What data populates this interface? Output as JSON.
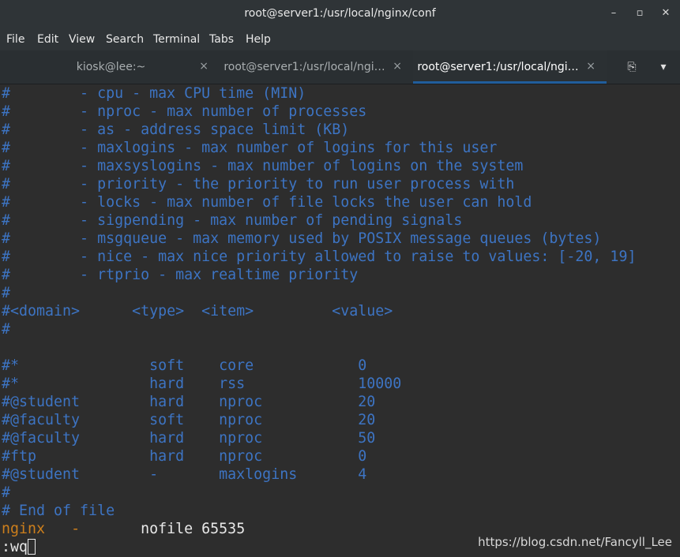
{
  "window": {
    "title": "root@server1:/usr/local/nginx/conf",
    "minimize": "–",
    "maximize": "▫",
    "close": "✕"
  },
  "menu": [
    "File",
    "Edit",
    "View",
    "Search",
    "Terminal",
    "Tabs",
    "Help"
  ],
  "tabs": [
    {
      "label": "kiosk@lee:~",
      "close": "×"
    },
    {
      "label": "root@server1:/usr/local/ngi…",
      "close": "×"
    },
    {
      "label": "root@server1:/usr/local/ngi…",
      "close": "×"
    }
  ],
  "tab_actions": {
    "new_tab_icon": "⎘",
    "menu_icon": "▾"
  },
  "terminal": {
    "lines": [
      "#        - cpu - max CPU time (MIN)",
      "#        - nproc - max number of processes",
      "#        - as - address space limit (KB)",
      "#        - maxlogins - max number of logins for this user",
      "#        - maxsyslogins - max number of logins on the system",
      "#        - priority - the priority to run user process with",
      "#        - locks - max number of file locks the user can hold",
      "#        - sigpending - max number of pending signals",
      "#        - msgqueue - max memory used by POSIX message queues (bytes)",
      "#        - nice - max nice priority allowed to raise to values: [-20, 19]",
      "#        - rtprio - max realtime priority",
      "#",
      "#<domain>      <type>  <item>         <value>",
      "#",
      "",
      "#*               soft    core            0",
      "#*               hard    rss             10000",
      "#@student        hard    nproc           20",
      "#@faculty        soft    nproc           20",
      "#@faculty        hard    nproc           50",
      "#ftp             hard    nproc           0",
      "#@student        -       maxlogins       4",
      "#",
      "# End of file"
    ],
    "nginx_line": {
      "domain": "nginx",
      "type": "-",
      "item_value": "nofile 65535",
      "domain_gap": "   ",
      "type_gap": "       "
    },
    "command": ":wq"
  },
  "watermark": "https://blog.csdn.net/Fancyll_Lee"
}
